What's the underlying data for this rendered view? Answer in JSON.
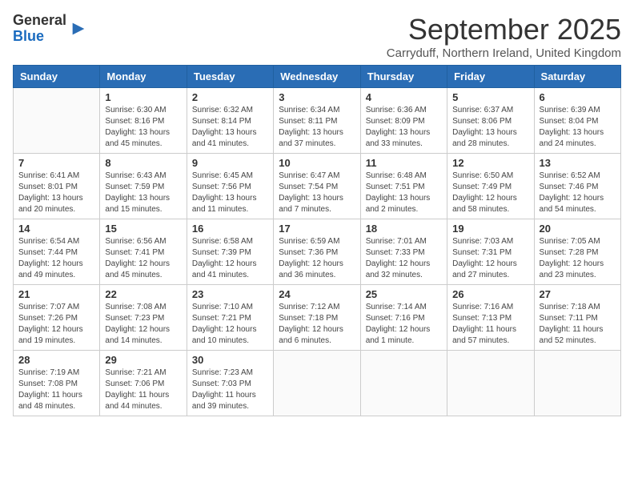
{
  "header": {
    "logo_general": "General",
    "logo_blue": "Blue",
    "month_title": "September 2025",
    "subtitle": "Carryduff, Northern Ireland, United Kingdom"
  },
  "weekdays": [
    "Sunday",
    "Monday",
    "Tuesday",
    "Wednesday",
    "Thursday",
    "Friday",
    "Saturday"
  ],
  "weeks": [
    [
      {
        "day": "",
        "info": ""
      },
      {
        "day": "1",
        "info": "Sunrise: 6:30 AM\nSunset: 8:16 PM\nDaylight: 13 hours\nand 45 minutes."
      },
      {
        "day": "2",
        "info": "Sunrise: 6:32 AM\nSunset: 8:14 PM\nDaylight: 13 hours\nand 41 minutes."
      },
      {
        "day": "3",
        "info": "Sunrise: 6:34 AM\nSunset: 8:11 PM\nDaylight: 13 hours\nand 37 minutes."
      },
      {
        "day": "4",
        "info": "Sunrise: 6:36 AM\nSunset: 8:09 PM\nDaylight: 13 hours\nand 33 minutes."
      },
      {
        "day": "5",
        "info": "Sunrise: 6:37 AM\nSunset: 8:06 PM\nDaylight: 13 hours\nand 28 minutes."
      },
      {
        "day": "6",
        "info": "Sunrise: 6:39 AM\nSunset: 8:04 PM\nDaylight: 13 hours\nand 24 minutes."
      }
    ],
    [
      {
        "day": "7",
        "info": "Sunrise: 6:41 AM\nSunset: 8:01 PM\nDaylight: 13 hours\nand 20 minutes."
      },
      {
        "day": "8",
        "info": "Sunrise: 6:43 AM\nSunset: 7:59 PM\nDaylight: 13 hours\nand 15 minutes."
      },
      {
        "day": "9",
        "info": "Sunrise: 6:45 AM\nSunset: 7:56 PM\nDaylight: 13 hours\nand 11 minutes."
      },
      {
        "day": "10",
        "info": "Sunrise: 6:47 AM\nSunset: 7:54 PM\nDaylight: 13 hours\nand 7 minutes."
      },
      {
        "day": "11",
        "info": "Sunrise: 6:48 AM\nSunset: 7:51 PM\nDaylight: 13 hours\nand 2 minutes."
      },
      {
        "day": "12",
        "info": "Sunrise: 6:50 AM\nSunset: 7:49 PM\nDaylight: 12 hours\nand 58 minutes."
      },
      {
        "day": "13",
        "info": "Sunrise: 6:52 AM\nSunset: 7:46 PM\nDaylight: 12 hours\nand 54 minutes."
      }
    ],
    [
      {
        "day": "14",
        "info": "Sunrise: 6:54 AM\nSunset: 7:44 PM\nDaylight: 12 hours\nand 49 minutes."
      },
      {
        "day": "15",
        "info": "Sunrise: 6:56 AM\nSunset: 7:41 PM\nDaylight: 12 hours\nand 45 minutes."
      },
      {
        "day": "16",
        "info": "Sunrise: 6:58 AM\nSunset: 7:39 PM\nDaylight: 12 hours\nand 41 minutes."
      },
      {
        "day": "17",
        "info": "Sunrise: 6:59 AM\nSunset: 7:36 PM\nDaylight: 12 hours\nand 36 minutes."
      },
      {
        "day": "18",
        "info": "Sunrise: 7:01 AM\nSunset: 7:33 PM\nDaylight: 12 hours\nand 32 minutes."
      },
      {
        "day": "19",
        "info": "Sunrise: 7:03 AM\nSunset: 7:31 PM\nDaylight: 12 hours\nand 27 minutes."
      },
      {
        "day": "20",
        "info": "Sunrise: 7:05 AM\nSunset: 7:28 PM\nDaylight: 12 hours\nand 23 minutes."
      }
    ],
    [
      {
        "day": "21",
        "info": "Sunrise: 7:07 AM\nSunset: 7:26 PM\nDaylight: 12 hours\nand 19 minutes."
      },
      {
        "day": "22",
        "info": "Sunrise: 7:08 AM\nSunset: 7:23 PM\nDaylight: 12 hours\nand 14 minutes."
      },
      {
        "day": "23",
        "info": "Sunrise: 7:10 AM\nSunset: 7:21 PM\nDaylight: 12 hours\nand 10 minutes."
      },
      {
        "day": "24",
        "info": "Sunrise: 7:12 AM\nSunset: 7:18 PM\nDaylight: 12 hours\nand 6 minutes."
      },
      {
        "day": "25",
        "info": "Sunrise: 7:14 AM\nSunset: 7:16 PM\nDaylight: 12 hours\nand 1 minute."
      },
      {
        "day": "26",
        "info": "Sunrise: 7:16 AM\nSunset: 7:13 PM\nDaylight: 11 hours\nand 57 minutes."
      },
      {
        "day": "27",
        "info": "Sunrise: 7:18 AM\nSunset: 7:11 PM\nDaylight: 11 hours\nand 52 minutes."
      }
    ],
    [
      {
        "day": "28",
        "info": "Sunrise: 7:19 AM\nSunset: 7:08 PM\nDaylight: 11 hours\nand 48 minutes."
      },
      {
        "day": "29",
        "info": "Sunrise: 7:21 AM\nSunset: 7:06 PM\nDaylight: 11 hours\nand 44 minutes."
      },
      {
        "day": "30",
        "info": "Sunrise: 7:23 AM\nSunset: 7:03 PM\nDaylight: 11 hours\nand 39 minutes."
      },
      {
        "day": "",
        "info": ""
      },
      {
        "day": "",
        "info": ""
      },
      {
        "day": "",
        "info": ""
      },
      {
        "day": "",
        "info": ""
      }
    ]
  ]
}
